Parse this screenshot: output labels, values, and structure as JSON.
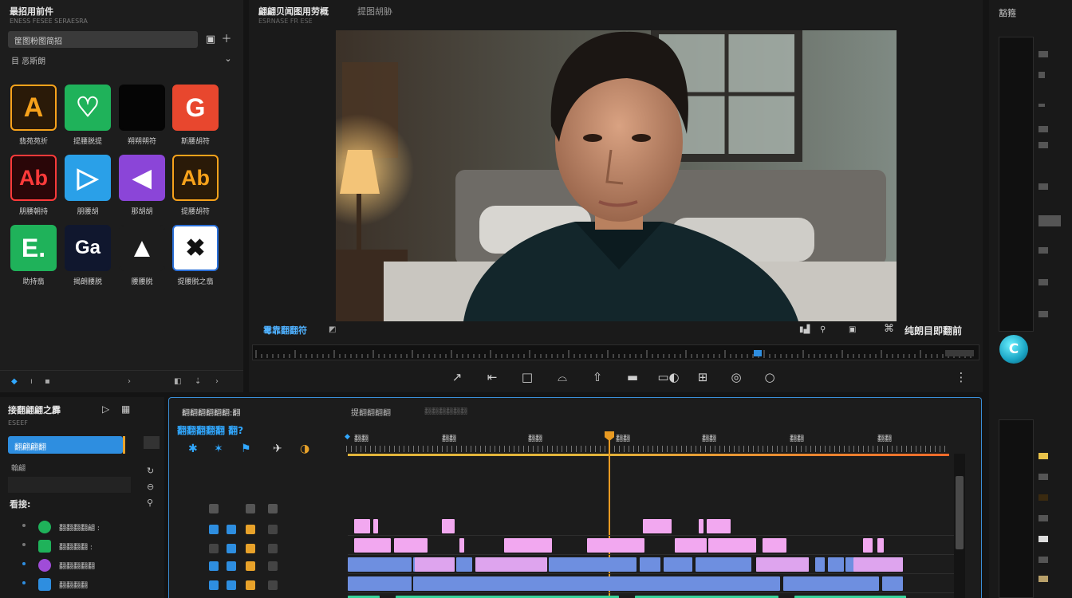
{
  "assets": {
    "title": "最招用前件",
    "subtitle": "ENESS FESEE SERAESRA",
    "search": "筐图粉图简招",
    "filter": "目 恶斯朗",
    "tiles": [
      {
        "glyph": "A",
        "label": "翡苑苑折",
        "bg": "#2a1a08",
        "fg": "#f7a21b",
        "border": "#f7a21b"
      },
      {
        "glyph": "♡",
        "label": "提腰脱提",
        "bg": "#1fb25a",
        "fg": "#ffffff",
        "border": "#1fb25a"
      },
      {
        "glyph": "",
        "label": "朔朔朔符",
        "bg": "#050505",
        "fg": "#ffffff",
        "border": "#050505"
      },
      {
        "glyph": "G",
        "label": "斯腰胡符",
        "bg": "#e8472e",
        "fg": "#ffffff",
        "border": "#e8472e"
      },
      {
        "glyph": "Ab",
        "label": "朋腰朝持",
        "bg": "#2a0608",
        "fg": "#ff3a3a",
        "border": "#ff3a3a"
      },
      {
        "glyph": "▷",
        "label": "朋腰胡",
        "bg": "#2aa0e8",
        "fg": "#ffffff",
        "border": "#2aa0e8"
      },
      {
        "glyph": "◀",
        "label": "那胡胡",
        "bg": "#8b45d8",
        "fg": "#ffffff",
        "border": "#8b45d8"
      },
      {
        "glyph": "Ab",
        "label": "提腰胡符",
        "bg": "#2a1a08",
        "fg": "#f7a21b",
        "border": "#f7a21b"
      },
      {
        "glyph": "E.",
        "label": "助持翡",
        "bg": "#1fb25a",
        "fg": "#ffffff",
        "border": "#1fb25a"
      },
      {
        "glyph": "Ga",
        "label": "揭朗腰脱",
        "bg": "#10172e",
        "fg": "#ffffff",
        "border": "#10172e"
      },
      {
        "glyph": "▲",
        "label": "腰腰脱",
        "bg": "#1d1d1d",
        "fg": "#ffffff",
        "border": "#1d1d1d"
      },
      {
        "glyph": "✖",
        "label": "提腰脱之翡",
        "bg": "#ffffff",
        "fg": "#111111",
        "border": "#2a6fd8"
      }
    ]
  },
  "viewer": {
    "title": "翩翩贝闻图用劳概",
    "title2": "提图胡胁",
    "subtitle": "ESRNASE FR ESE",
    "timecode": "霉靠翻翻符",
    "status": "纯朗目即翻前"
  },
  "right_sidebar": {
    "title": "豁箍",
    "badge_glyph": "C"
  },
  "project": {
    "title": "接翻翩翩之霹",
    "subtitle": "ESEEF",
    "selected_item": "翻翩翩翻",
    "item2": "翰翩",
    "section": "看接:",
    "rows": [
      {
        "label": "翻翻翻翻翩 :",
        "color": "#1fb25a"
      },
      {
        "label": "翻翻翻翻 :",
        "color": "#1fb25a"
      },
      {
        "label": "翻翻翻翻翻",
        "color": "#a04cd8"
      },
      {
        "label": "翻翻翻翻",
        "color": "#2e8ee0"
      }
    ]
  },
  "timeline": {
    "title": "翻翻翻翻翻翻:翻",
    "title2": "提翻翻翻翻",
    "title3": "翻翻翻翻翻翻",
    "subtitle": "翻翻翻翻翻 翻?",
    "ruler_labels": [
      "翻翻",
      "翻翻",
      "翻翻",
      "翻翻",
      "翻翻",
      "翻翻",
      "翻翻"
    ]
  },
  "colors": {
    "accent": "#31a8ff",
    "playhead": "#e89a22",
    "clip_pink": "#f2a8f0",
    "clip_blue": "#6e8fe0",
    "clip_green": "#37d49a"
  }
}
